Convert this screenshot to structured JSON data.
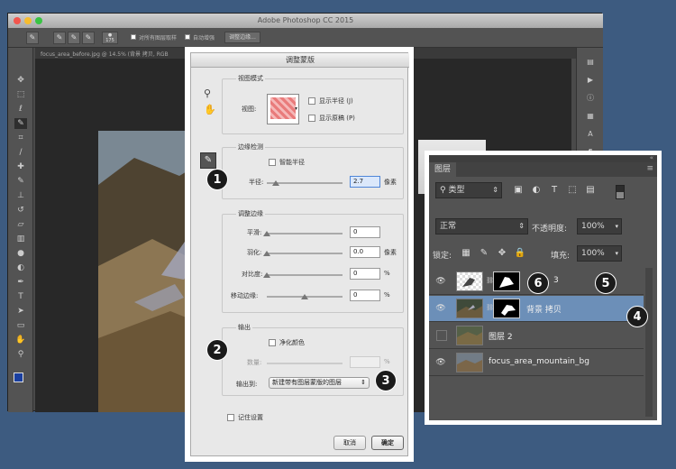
{
  "photoshop": {
    "title": "Adobe Photoshop CC 2015",
    "document_tab": "focus_area_before.jpg @ 14.5% (背景 拷贝, RGB",
    "options": {
      "sample_all_layers": "对所有图层取样",
      "auto_enhance": "自动增强",
      "refine_edge": "调整边缘...",
      "brush_size": "175"
    }
  },
  "dialog": {
    "title": "调整蒙版",
    "view_mode": {
      "group_label": "视图模式",
      "view_label": "视图:",
      "show_radius": "显示半径 (J)",
      "show_original": "显示原稿 (P)"
    },
    "edge_detection": {
      "group_label": "边缘检测",
      "smart_radius": "智能半径",
      "radius_label": "半径:",
      "radius_value": "2.7",
      "radius_unit": "像素",
      "radius_fraction": 0.12
    },
    "adjust_edge": {
      "group_label": "调整边缘",
      "smooth_label": "平滑:",
      "smooth_value": "0",
      "smooth_fraction": 0,
      "feather_label": "羽化:",
      "feather_value": "0.0",
      "feather_unit": "像素",
      "feather_fraction": 0,
      "contrast_label": "对比度:",
      "contrast_value": "0",
      "contrast_unit": "%",
      "contrast_fraction": 0,
      "shift_label": "移动边缘:",
      "shift_value": "0",
      "shift_unit": "%",
      "shift_fraction": 0.5
    },
    "output": {
      "group_label": "输出",
      "decontaminate": "净化颜色",
      "amount_label": "数量:",
      "amount_unit": "%",
      "output_to_label": "输出到:",
      "output_to_value": "新建带有图层蒙版的图层"
    },
    "remember": "记住设置",
    "cancel": "取消",
    "ok": "确定"
  },
  "markers": [
    "1",
    "2",
    "3",
    "4",
    "5",
    "6"
  ],
  "layers_panel": {
    "tab": "图层",
    "filter_label": "类型",
    "blend_mode": "正常",
    "opacity_label": "不透明度:",
    "opacity_value": "100%",
    "lock_label": "锁定:",
    "fill_label": "填充:",
    "fill_value": "100%",
    "layers": [
      {
        "name": "3",
        "visible": true
      },
      {
        "name": "背景 拷贝",
        "visible": true,
        "selected": true
      },
      {
        "name": "图层 2",
        "visible": false
      },
      {
        "name": "focus_area_mountain_bg",
        "visible": true
      }
    ]
  },
  "colors": {
    "selected_layer": "#6c8fb8",
    "background": "#3d5b80"
  }
}
